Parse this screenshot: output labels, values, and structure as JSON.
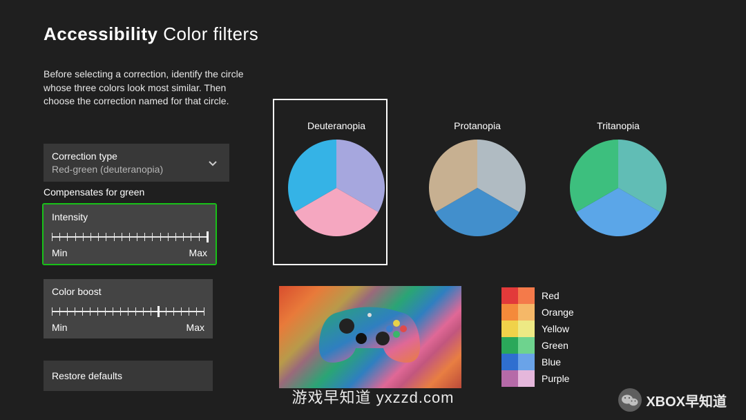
{
  "header": {
    "strong": "Accessibility",
    "light": "Color filters"
  },
  "instructions": "Before selecting a correction, identify the circle whose three colors look most similar. Then choose the correction named for that circle.",
  "correction": {
    "label": "Correction type",
    "value": "Red-green (deuteranopia)"
  },
  "compensates": "Compensates for green",
  "intensity": {
    "label": "Intensity",
    "min": "Min",
    "max": "Max",
    "ticks": 21,
    "value": 21
  },
  "colorboost": {
    "label": "Color boost",
    "min": "Min",
    "max": "Max",
    "ticks": 21,
    "value": 15
  },
  "restore": "Restore defaults",
  "circles": [
    {
      "label": "Deuteranopia",
      "colors": {
        "top_left": "#35b3e6",
        "top_right": "#a6a7de",
        "bottom": "#f5a7c0"
      }
    },
    {
      "label": "Protanopia",
      "colors": {
        "top_left": "#c7b091",
        "top_right": "#b0bbc2",
        "bottom": "#428fcc"
      }
    },
    {
      "label": "Tritanopia",
      "colors": {
        "top_left": "#3dbf7e",
        "top_right": "#61bdb5",
        "bottom": "#5ba6e8"
      }
    }
  ],
  "color_rows": [
    {
      "a": "#e23a3a",
      "b": "#f47a4a",
      "label": "Red"
    },
    {
      "a": "#f48a3a",
      "b": "#f5b868",
      "label": "Orange"
    },
    {
      "a": "#f0d24a",
      "b": "#ede984",
      "label": "Yellow"
    },
    {
      "a": "#2aa85a",
      "b": "#6ed38e",
      "label": "Green"
    },
    {
      "a": "#2f6fd0",
      "b": "#6aa3e8",
      "label": "Blue"
    },
    {
      "a": "#b66aa8",
      "b": "#e5b7db",
      "label": "Purple"
    }
  ],
  "watermark_center": "游戏早知道 yxzzd.com",
  "watermark_right": "XBOX早知道"
}
